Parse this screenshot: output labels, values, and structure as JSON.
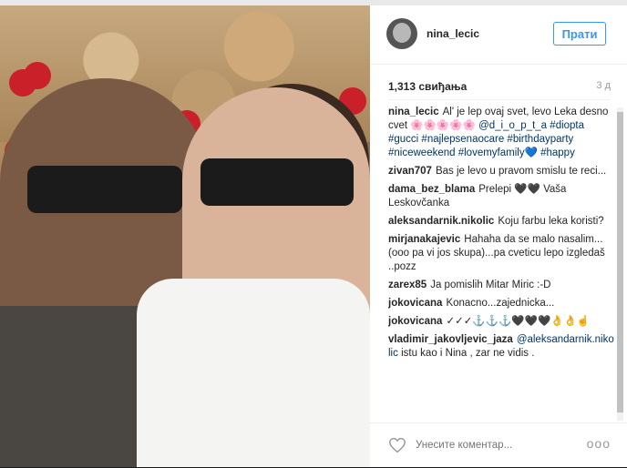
{
  "post": {
    "username": "nina_lecic",
    "follow_label": "Прати",
    "likes": "1,313 свиђања",
    "time": "3 д"
  },
  "comments": [
    {
      "author": "nina_lecic",
      "text": "Al' je lep ovaj svet, levo Leka desno cvet 🌸🌸🌸🌸🌸",
      "mention": "@d_i_o_p_t_a",
      "tags": "#diopta #gucci #najlepsenaocare #birthdayparty #niceweekend #lovemyfamily💙 #happy"
    },
    {
      "author": "zivan707",
      "text": "Bas je levo u pravom smislu te reci..."
    },
    {
      "author": "dama_bez_blama",
      "text": "Prelepi 🖤🖤 Vaša Leskovčanka"
    },
    {
      "author": "aleksandarnik.nikolic",
      "text": "Koju farbu leka koristi?"
    },
    {
      "author": "mirjanakajevic",
      "text": "Hahaha da se malo nasalim...(ooo pa vi jos skupa)...pa cveticu lepo izgledaš ..pozz"
    },
    {
      "author": "zarex85",
      "text": "Ja pomislih Mitar Miric :-D"
    },
    {
      "author": "jokovicana",
      "text": "Konacno...zajednicka..."
    },
    {
      "author": "jokovicana",
      "text": "✓✓✓⚓⚓⚓🖤🖤🖤👌👌☝"
    },
    {
      "author": "vladimir_jakovljevic_jaza",
      "mention": "@aleksandarnik.nikolic",
      "text": "istu kao i Nina , zar ne vidis ."
    }
  ],
  "footer": {
    "comment_placeholder": "Унесите коментар...",
    "more_label": "ooo"
  },
  "icons": {
    "heart": "heart-icon",
    "avatar": "avatar"
  },
  "colors": {
    "follow_blue": "#3897f0",
    "link_blue": "#003569",
    "text": "#262626"
  }
}
